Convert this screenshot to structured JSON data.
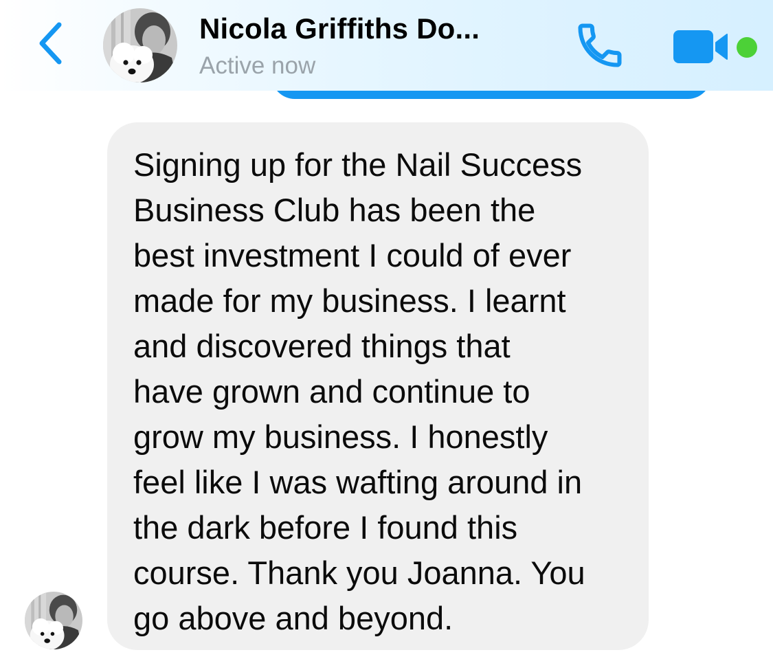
{
  "header": {
    "contact_name": "Nicola Griffiths Do...",
    "status": "Active now"
  },
  "colors": {
    "accent": "#1597f2",
    "online": "#4cd137",
    "status_text": "#9aa3aa",
    "bubble_received": "#f0f0f0"
  },
  "icons": {
    "back": "chevron-left-icon",
    "call": "phone-icon",
    "video": "video-camera-icon",
    "presence": "online-dot-icon"
  },
  "conversation": {
    "messages": [
      {
        "direction": "received",
        "text": "Signing up for the Nail Success\nBusiness Club has been the\nbest investment I could of ever\nmade for my business.  I learnt\nand discovered things that\nhave grown and continue to\ngrow my business. I honestly\nfeel like I was wafting around in\nthe dark before I found this\ncourse. Thank you Joanna. You\ngo above and beyond."
      }
    ]
  }
}
